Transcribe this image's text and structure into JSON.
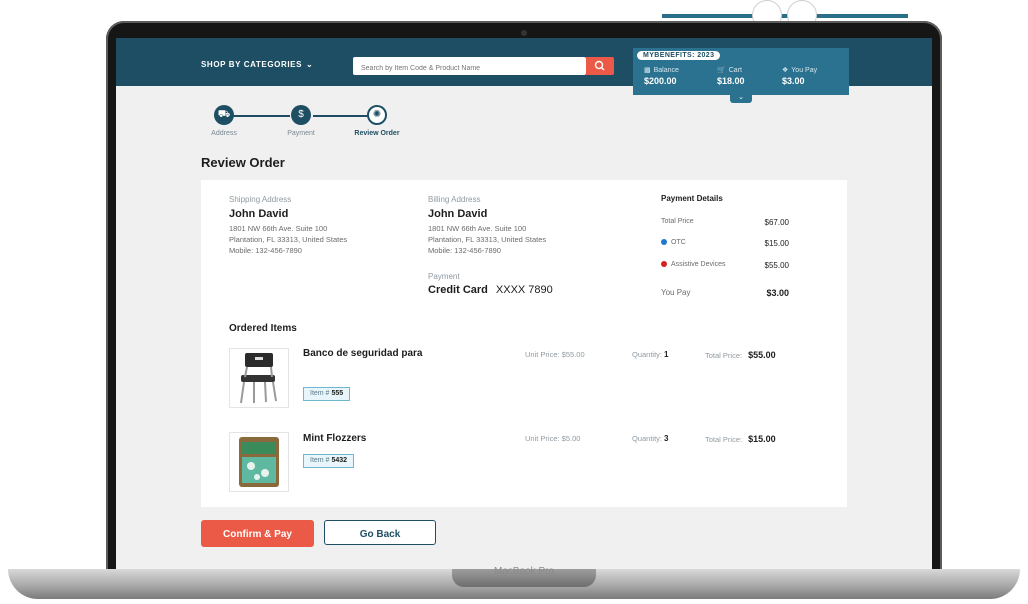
{
  "header": {
    "shop_by_categories": "SHOP BY CATEGORIES",
    "search_placeholder": "Search by Item Code & Product Name",
    "benefits_tag": "MYBENEFITS: 2023",
    "balance_label": "Balance",
    "balance_value": "$200.00",
    "cart_label": "Cart",
    "cart_value": "$18.00",
    "you_pay_label": "You Pay",
    "you_pay_value": "$3.00"
  },
  "stepper": {
    "steps": [
      {
        "label": "Address",
        "icon": "truck-icon",
        "state": "done"
      },
      {
        "label": "Payment",
        "icon": "dollar-icon",
        "state": "done"
      },
      {
        "label": "Review Order",
        "icon": "review-icon",
        "state": "current"
      }
    ]
  },
  "page": {
    "title": "Review Order"
  },
  "shipping": {
    "label": "Shipping Address",
    "name": "John David",
    "line1": "1801 NW 66th Ave. Suite 100",
    "line2": "Plantation, FL 33313, United States",
    "mobile": "Mobile: 132-456-7890"
  },
  "billing": {
    "label": "Billing Address",
    "name": "John David",
    "line1": "1801 NW 66th Ave. Suite 100",
    "line2": "Plantation, FL 33313, United States",
    "mobile": "Mobile: 132-456-7890",
    "payment_label": "Payment",
    "payment_method": "Credit Card",
    "card_number": "XXXX 7890"
  },
  "payment_details": {
    "title": "Payment Details",
    "rows": [
      {
        "label": "Total Price",
        "value": "$67.00"
      },
      {
        "label": "OTC",
        "value": "$15.00",
        "dot_color": "#1f77d0"
      },
      {
        "label": "Assistive Devices",
        "value": "$55.00",
        "dot_color": "#d61f1f"
      },
      {
        "label": "You Pay",
        "value": "$3.00"
      }
    ]
  },
  "ordered_items": {
    "title": "Ordered Items",
    "unit_price_label": "Unit Price:",
    "quantity_label": "Quantity:",
    "total_price_label": "Total Price:",
    "item_label": "Item #",
    "items": [
      {
        "name": "Banco de seguridad para",
        "item_no": "555",
        "unit_price": "$55.00",
        "quantity": "1",
        "total_price": "$55.00"
      },
      {
        "name": "Mint Flozzers",
        "item_no": "5432",
        "unit_price": "$5.00",
        "quantity": "3",
        "total_price": "$15.00"
      }
    ]
  },
  "actions": {
    "confirm": "Confirm & Pay",
    "back": "Go Back"
  },
  "device": {
    "label": "MacBook Pro"
  },
  "colors": {
    "primary": "#1e4e63",
    "accent": "#ea5a47",
    "benefits_bg": "#2a7290"
  }
}
